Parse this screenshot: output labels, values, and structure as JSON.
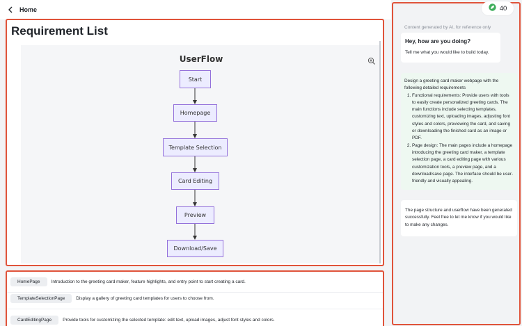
{
  "topbar": {
    "home_label": "Home"
  },
  "left": {
    "title": "Requirement List",
    "flow": {
      "title": "UserFlow",
      "nodes": [
        "Start",
        "Homepage",
        "Template Selection",
        "Card Editing",
        "Preview",
        "Download/Save"
      ]
    }
  },
  "pages": [
    {
      "name": "HomePage",
      "desc": "Introduction to the greeting card maker, feature highlights, and entry point to start creating a card."
    },
    {
      "name": "TemplateSelectionPage",
      "desc": "Display a gallery of greeting card templates for users to choose from."
    },
    {
      "name": "CardEditingPage",
      "desc": "Provide tools for customizing the selected template: edit text, upload images, adjust font styles and colors."
    }
  ],
  "chat": {
    "credits": "40",
    "notice": "Content generated by AI, for reference only",
    "greeting": {
      "heading": "Hey, how are you doing?",
      "text": "Tell me what you would like to build today."
    },
    "request": {
      "intro": "Design a greeting card maker webpage with the following detailed requirements",
      "items": [
        "Functional requirements: Provide users with tools to easily create personalized greeting cards. The main functions include selecting templates, customizing text, uploading images, adjusting font styles and colors, previewing the card, and saving or downloading the finished card as an image or PDF.",
        "Page design: The main pages include a homepage introducing the greeting card maker, a template selection page, a card editing page with various customization tools, a preview page, and a download/save page. The interface should be user-friendly and visually appealing."
      ]
    },
    "reply": "The page structure and userflow have been generated successfully. Feel free to let me know if you would like to make any changes."
  },
  "colors": {
    "accent": "#e0533a",
    "node_fill": "#ececff",
    "node_border": "#9370db",
    "request_bg": "#eef8f1"
  }
}
